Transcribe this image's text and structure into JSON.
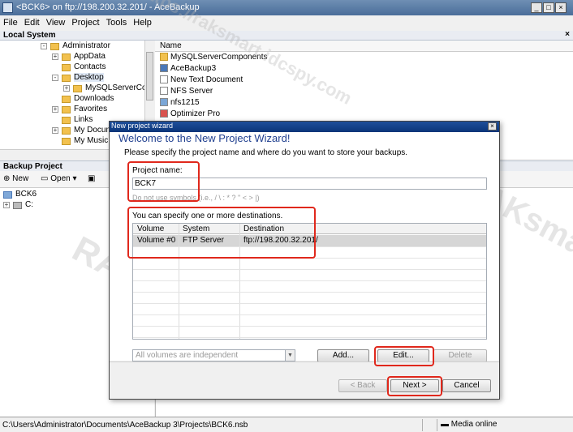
{
  "window": {
    "title": "<BCK6> on ftp://198.200.32.201/ - AceBackup"
  },
  "menu": [
    "File",
    "Edit",
    "View",
    "Project",
    "Tools",
    "Help"
  ],
  "local_system": {
    "header": "Local System",
    "tree": [
      {
        "label": "Administrator",
        "depth": 0
      },
      {
        "label": "AppData",
        "depth": 1
      },
      {
        "label": "Contacts",
        "depth": 1
      },
      {
        "label": "Desktop",
        "depth": 1
      },
      {
        "label": "MySQLServerCom",
        "depth": 2
      },
      {
        "label": "Downloads",
        "depth": 1
      },
      {
        "label": "Favorites",
        "depth": 1
      },
      {
        "label": "Links",
        "depth": 1
      },
      {
        "label": "My Docum",
        "depth": 1
      },
      {
        "label": "My Music",
        "depth": 1
      }
    ],
    "files_header": "Name",
    "files": [
      "MySQLServerComponents",
      "AceBackup3",
      "New Text Document",
      "NFS Server",
      "nfs1215",
      "Optimizer Pro"
    ]
  },
  "backup_project": {
    "header": "Backup Project",
    "toolbar": {
      "new": "New",
      "open": "Open"
    },
    "tree": [
      "BCK6",
      "C:"
    ]
  },
  "status": {
    "path": "C:\\Users\\Administrator\\Documents\\AceBackup 3\\Projects\\BCK6.nsb",
    "media": "Media online"
  },
  "wizard": {
    "title": "New project wizard",
    "heading": "Welcome to the New Project Wizard!",
    "subtitle": "Please specify the project name and where do you want to store your backups.",
    "project_name_label": "Project name:",
    "project_name_value": "BCK7",
    "hint": "Do not use symbols (i.e., / \\ : * ? \" < > |)",
    "destinations_label": "You can specify one or more destinations.",
    "columns": [
      "Volume",
      "System",
      "Destination"
    ],
    "rows": [
      {
        "volume": "Volume #0",
        "system": "FTP Server",
        "destination": "ftp://198.200.32.201/"
      }
    ],
    "volume_mode": "All volumes are independent",
    "buttons": {
      "add": "Add...",
      "edit": "Edit...",
      "delete": "Delete",
      "back": "< Back",
      "next": "Next >",
      "cancel": "Cancel"
    }
  },
  "watermark": [
    "RAKsmart",
    "-https://raksmart.idcspy.com"
  ]
}
